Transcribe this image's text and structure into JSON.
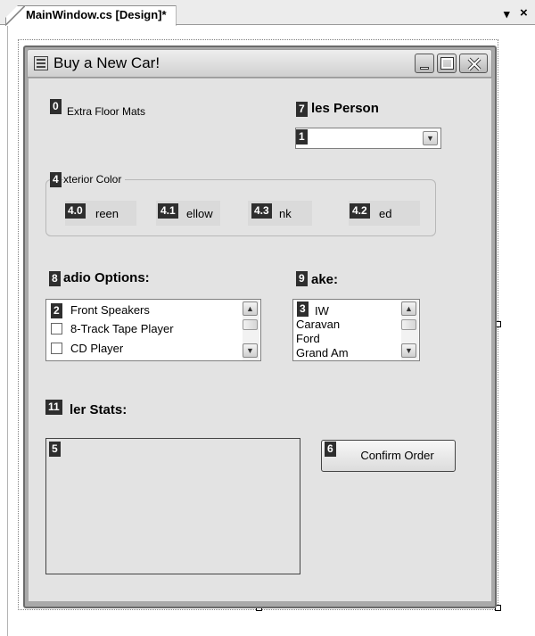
{
  "ide": {
    "document_tab": "MainWindow.cs [Design]*",
    "dropdown_glyph": "▾",
    "close_glyph": "×"
  },
  "window": {
    "title": "Buy a New Car!",
    "buttons": [
      "minimize",
      "maximize",
      "close"
    ]
  },
  "badges": [
    "0",
    "7",
    "1",
    "4",
    "4.0",
    "4.1",
    "4.3",
    "4.2",
    "8",
    "9",
    "2",
    "3",
    "11",
    "5",
    "6"
  ],
  "form": {
    "extra_floor_mats_label": "Extra Floor Mats",
    "sales_person_label": "les Person",
    "sales_person_value": "",
    "exterior_color": {
      "group_title": "xterior Color",
      "options": [
        "reen",
        "ellow",
        "nk",
        "ed"
      ]
    },
    "radio_options": {
      "label": "adio Options:",
      "items": [
        "Front Speakers",
        "8-Track Tape Player",
        "CD Player"
      ]
    },
    "make": {
      "label": "ake:",
      "items": [
        "IW",
        "Caravan",
        "Ford",
        "Grand Am"
      ]
    },
    "order_stats": {
      "label": "ler Stats:"
    },
    "confirm_button": "Confirm Order"
  },
  "colors": {
    "badge_bg": "#2e2e2e",
    "form_client_bg": "#e3e3e3",
    "frame": "#a9a9a9"
  },
  "icons": [
    "form-app-icon",
    "minimize-icon",
    "maximize-icon",
    "close-icon",
    "chevron-down-icon",
    "scroll-up-icon",
    "scroll-down-icon"
  ]
}
